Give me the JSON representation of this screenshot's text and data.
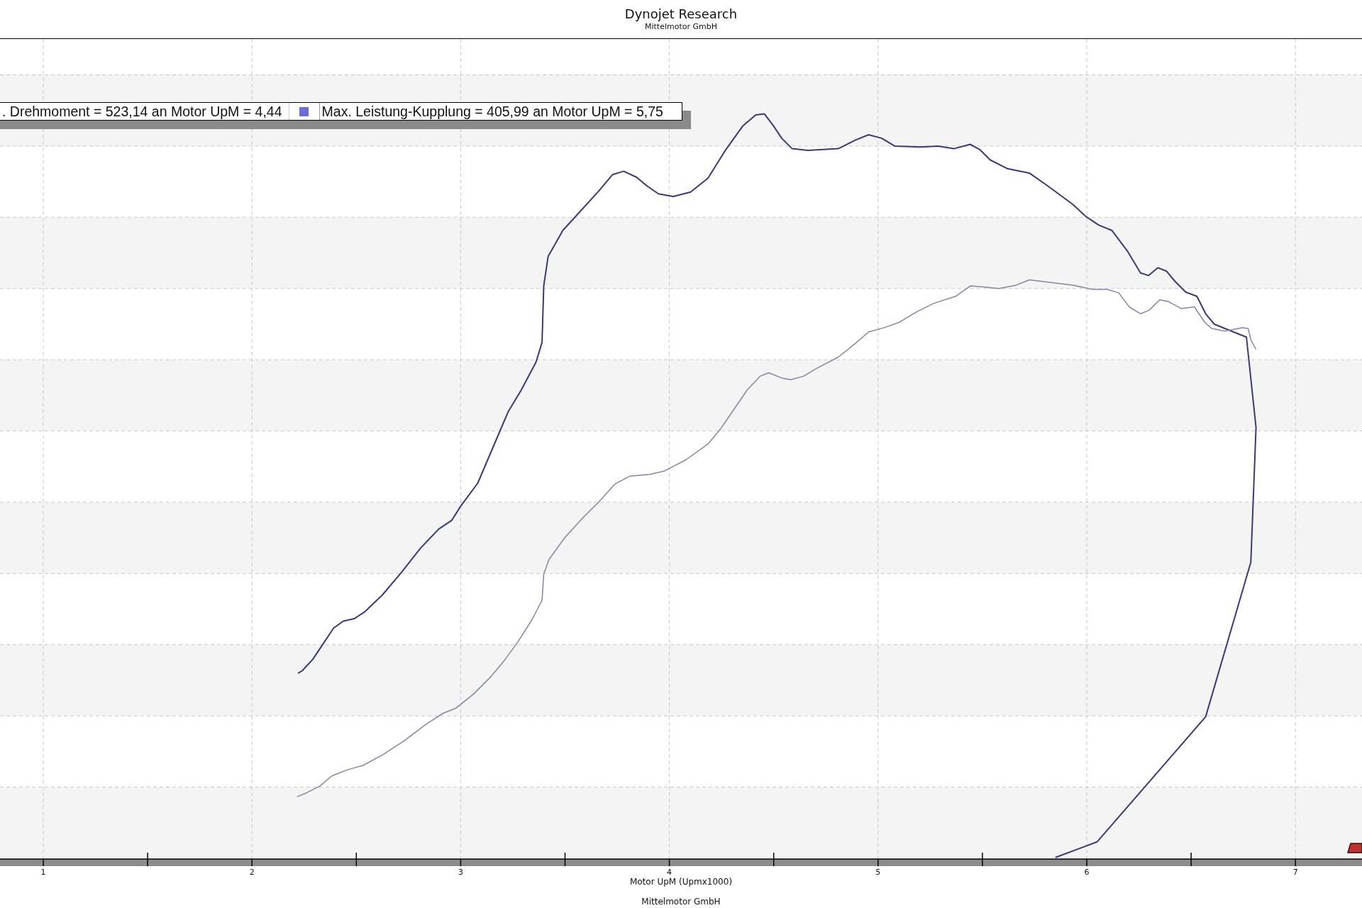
{
  "header": {
    "title": "Dynojet Research",
    "subtitle": "Mittelmotor GmbH"
  },
  "legend": [
    {
      "text": ". Drehmoment = 523,14 an Motor UpM = 4,44"
    },
    {
      "text": "Max. Leistung-Kupplung = 405,99 an Motor UpM = 5,75",
      "color": "#6b6be0"
    }
  ],
  "x_axis": {
    "ticks": [
      "1",
      "2",
      "3",
      "4",
      "5",
      "6",
      "7"
    ],
    "label": "Motor UpM (Upmx1000)"
  },
  "footer": "Mittelmotor GmbH"
}
